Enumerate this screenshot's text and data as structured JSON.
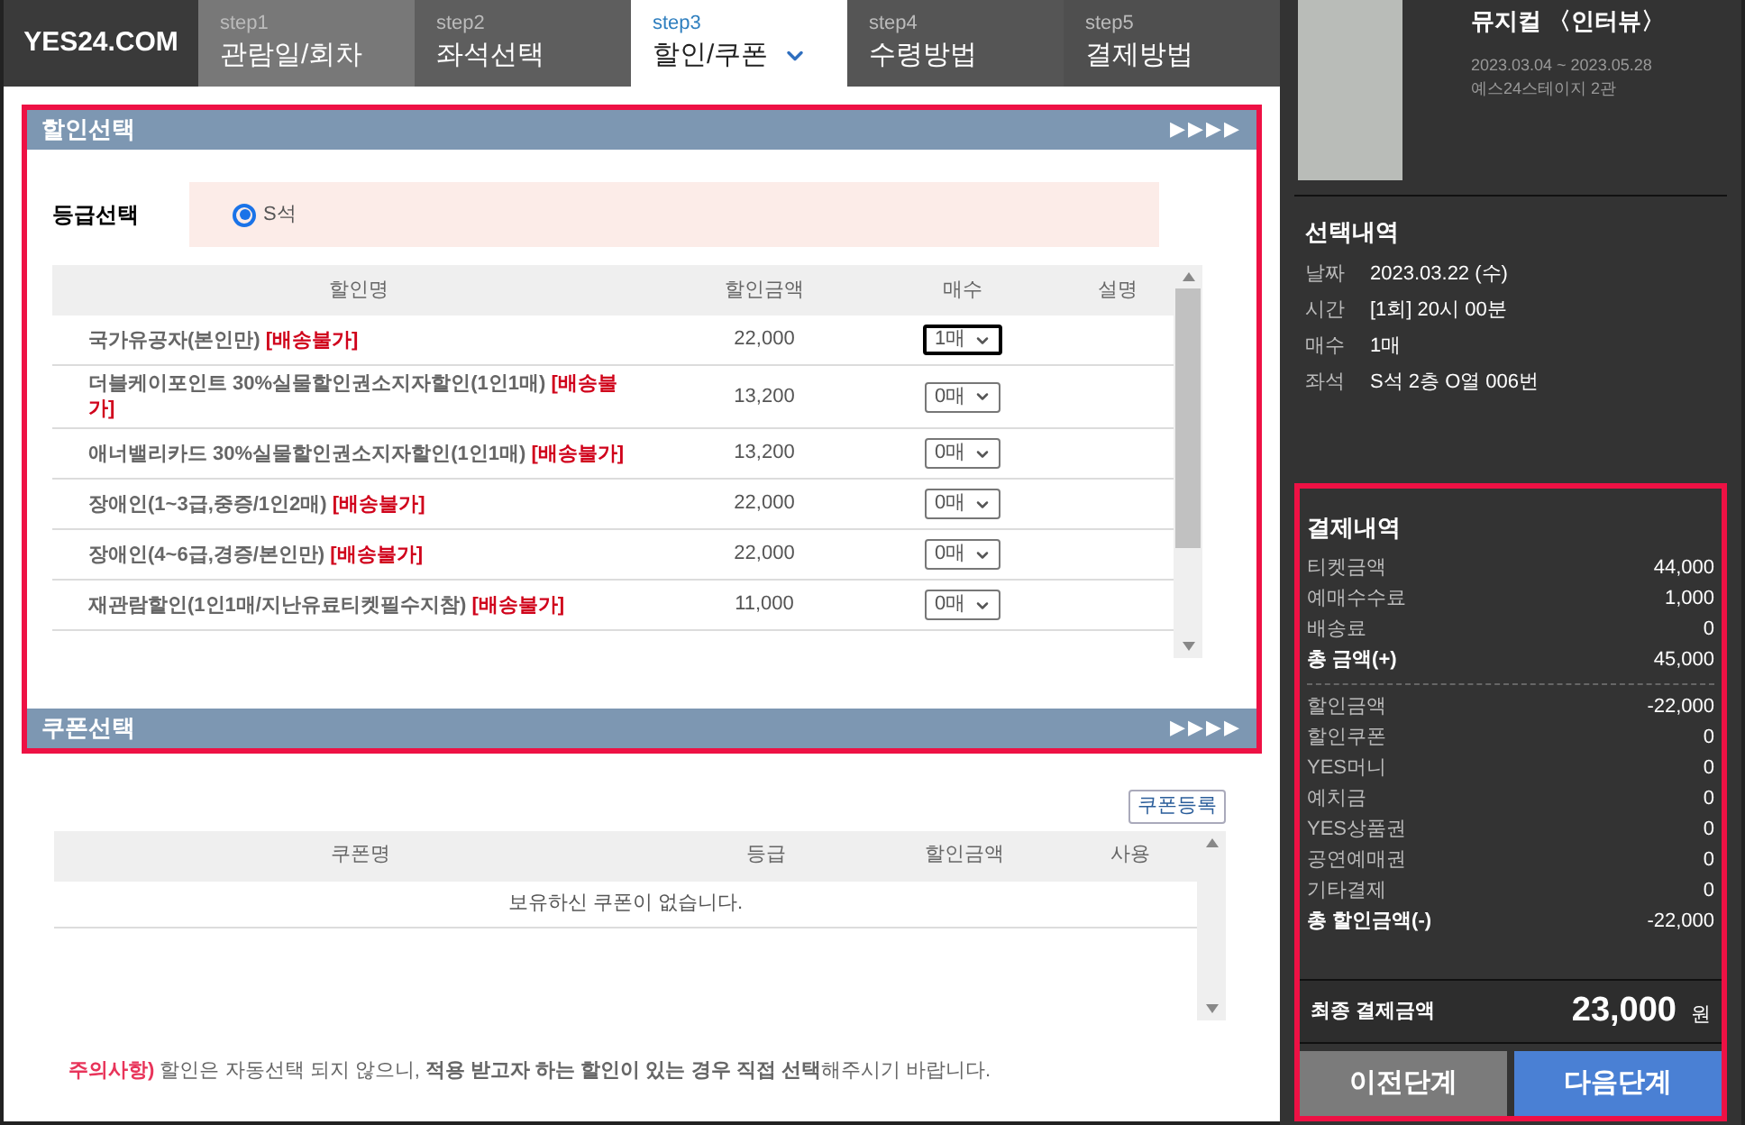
{
  "logo": "YES24.COM",
  "steps": [
    {
      "step": "step1",
      "label": "관람일/회차",
      "selected": false
    },
    {
      "step": "step2",
      "label": "좌석선택",
      "selected": false
    },
    {
      "step": "step3",
      "label": "할인/쿠폰",
      "selected": true
    },
    {
      "step": "step4",
      "label": "수령방법",
      "selected": false
    },
    {
      "step": "step5",
      "label": "결제방법",
      "selected": false
    }
  ],
  "discount": {
    "title": "할인선택",
    "arrows": "▶▶▶▶",
    "grade_label": "등급선택",
    "grades": [
      {
        "label": "S석",
        "selected": true
      }
    ],
    "columns": [
      "할인명",
      "할인금액",
      "매수",
      "설명"
    ],
    "rows": [
      {
        "name": "국가유공자(본인만)",
        "tag": "[배송불가]",
        "amount": "22,000",
        "qty": "1매",
        "focused": true
      },
      {
        "name": "더블케이포인트 30%실물할인권소지자할인(1인1매)",
        "tag": "[배송불가]",
        "amount": "13,200",
        "qty": "0매",
        "focused": false
      },
      {
        "name": "애너밸리카드 30%실물할인권소지자할인(1인1매)",
        "tag": "[배송불가]",
        "amount": "13,200",
        "qty": "0매",
        "focused": false
      },
      {
        "name": "장애인(1~3급,중증/1인2매)",
        "tag": "[배송불가]",
        "amount": "22,000",
        "qty": "0매",
        "focused": false
      },
      {
        "name": "장애인(4~6급,경증/본인만)",
        "tag": "[배송불가]",
        "amount": "22,000",
        "qty": "0매",
        "focused": false
      },
      {
        "name": "재관람할인(1인1매/지난유료티켓필수지참)",
        "tag": "[배송불가]",
        "amount": "11,000",
        "qty": "0매",
        "focused": false
      }
    ]
  },
  "coupon": {
    "title": "쿠폰선택",
    "arrows": "▶▶▶▶",
    "register_button": "쿠폰등록",
    "columns": [
      "쿠폰명",
      "등급",
      "할인금액",
      "사용"
    ],
    "empty_message": "보유하신 쿠폰이 없습니다."
  },
  "notice": {
    "lead": "주의사항)",
    "text": "할인은 자동선택 되지 않으니, **적용 받고자 하는 할인이 있는 경우 직접 선택**해주시기 바랍니다."
  },
  "show": {
    "title": "뮤지컬 〈인터뷰〉",
    "period": "2023.03.04 ~ 2023.05.28",
    "venue": "예스24스테이지 2관"
  },
  "selection": {
    "title": "선택내역",
    "items": [
      {
        "label": "날짜",
        "value": "2023.03.22 (수)"
      },
      {
        "label": "시간",
        "value": "[1회] 20시 00분"
      },
      {
        "label": "매수",
        "value": "1매"
      },
      {
        "label": "좌석",
        "value": "S석 2층 O열 006번"
      }
    ]
  },
  "payment": {
    "title": "결제내역",
    "charges": [
      {
        "label": "티켓금액",
        "value": "44,000",
        "total": false
      },
      {
        "label": "예매수수료",
        "value": "1,000",
        "total": false
      },
      {
        "label": "배송료",
        "value": "0",
        "total": false
      },
      {
        "label": "총 금액(+)",
        "value": "45,000",
        "total": true
      }
    ],
    "discounts": [
      {
        "label": "할인금액",
        "value": "-22,000",
        "total": false
      },
      {
        "label": "할인쿠폰",
        "value": "0",
        "total": false
      },
      {
        "label": "YES머니",
        "value": "0",
        "total": false
      },
      {
        "label": "예치금",
        "value": "0",
        "total": false
      },
      {
        "label": "YES상품권",
        "value": "0",
        "total": false
      },
      {
        "label": "공연예매권",
        "value": "0",
        "total": false
      },
      {
        "label": "기타결제",
        "value": "0",
        "total": false
      },
      {
        "label": "총 할인금액(-)",
        "value": "-22,000",
        "total": true
      }
    ],
    "final_label": "최종 결제금액",
    "final_amount": "23,000",
    "currency": "원"
  },
  "buttons": {
    "prev": "이전단계",
    "next": "다음단계"
  }
}
